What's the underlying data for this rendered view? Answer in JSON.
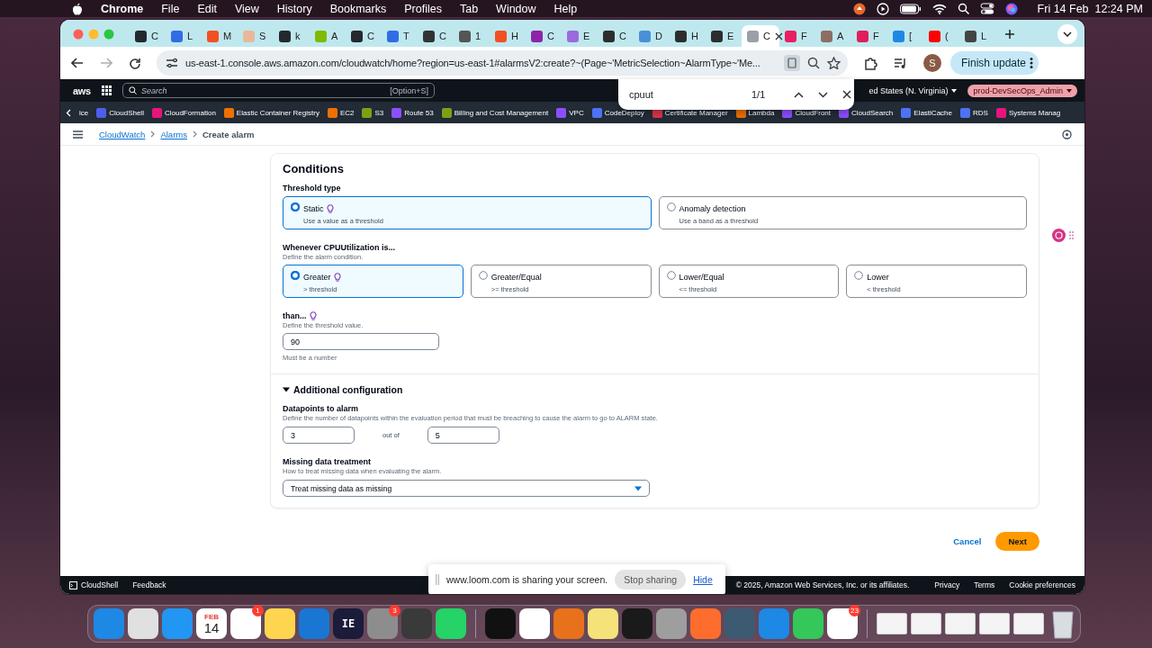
{
  "menu_bar": {
    "app": "Chrome",
    "menus": [
      "File",
      "Edit",
      "View",
      "History",
      "Bookmarks",
      "Profiles",
      "Tab",
      "Window",
      "Help"
    ],
    "clock": "Fri 14 Feb  12:24 PM"
  },
  "browser": {
    "tabs": [
      {
        "label": "C",
        "color": "#24292f",
        "selected": false
      },
      {
        "label": "L",
        "color": "#326ce5",
        "selected": false
      },
      {
        "label": "M",
        "color": "#f25022",
        "selected": false
      },
      {
        "label": "S",
        "color": "#e9b89a",
        "selected": false
      },
      {
        "label": "k",
        "color": "#24292f",
        "selected": false
      },
      {
        "label": "A",
        "color": "#7fba00",
        "selected": false
      },
      {
        "label": "C",
        "color": "#24292f",
        "selected": false
      },
      {
        "label": "T",
        "color": "#326ce5",
        "selected": false
      },
      {
        "label": "C",
        "color": "#333333",
        "selected": false
      },
      {
        "label": "1",
        "color": "#555555",
        "selected": false
      },
      {
        "label": "H",
        "color": "#f25022",
        "selected": false
      },
      {
        "label": "C",
        "color": "#8e24aa",
        "selected": false
      },
      {
        "label": "E",
        "color": "#9c6ade",
        "selected": false
      },
      {
        "label": "C",
        "color": "#2d2d2d",
        "selected": false
      },
      {
        "label": "D",
        "color": "#4a90d9",
        "selected": false
      },
      {
        "label": "H",
        "color": "#2d2d2d",
        "selected": false
      },
      {
        "label": "E",
        "color": "#2d2d2d",
        "selected": false
      },
      {
        "label": "C",
        "color": "#9aa0a6",
        "selected": true
      },
      {
        "label": "F",
        "color": "#e91e63",
        "selected": false
      },
      {
        "label": "A",
        "color": "#8d6e63",
        "selected": false
      },
      {
        "label": "F",
        "color": "#e01e5a",
        "selected": false
      },
      {
        "label": "[",
        "color": "#1e88e5",
        "selected": false
      },
      {
        "label": "(",
        "color": "#ff0000",
        "selected": false
      },
      {
        "label": "L",
        "color": "#444444",
        "selected": false
      }
    ],
    "address": "us-east-1.console.aws.amazon.com/cloudwatch/home?region=us-east-1#alarmsV2:create?~(Page~'MetricSelection~AlarmType~'Me...",
    "profile": "S",
    "update_button": "Finish update"
  },
  "find_bar": {
    "query": "cpuut",
    "count": "1/1"
  },
  "aws_header": {
    "logo": "aws",
    "search_placeholder": "Search",
    "shortcut": "[Option+S]",
    "region": "ed States (N. Virginia)",
    "account": "prod-DevSecOps_Admin"
  },
  "services_cut": "ice",
  "services": [
    {
      "label": "CloudShell",
      "color": "#4d5ee8"
    },
    {
      "label": "CloudFormation",
      "color": "#e7157b"
    },
    {
      "label": "Elastic Container Registry",
      "color": "#ed7100"
    },
    {
      "label": "EC2",
      "color": "#ed7100"
    },
    {
      "label": "S3",
      "color": "#7aa116"
    },
    {
      "label": "Route 53",
      "color": "#8c4fff"
    },
    {
      "label": "Billing and Cost Management",
      "color": "#7aa116"
    },
    {
      "label": "VPC",
      "color": "#8c4fff"
    },
    {
      "label": "CodeDeploy",
      "color": "#4d72f3"
    },
    {
      "label": "Certificate Manager",
      "color": "#dd344c"
    },
    {
      "label": "Lambda",
      "color": "#ed7100"
    },
    {
      "label": "CloudFront",
      "color": "#8c4fff"
    },
    {
      "label": "CloudSearch",
      "color": "#8c4fff"
    },
    {
      "label": "ElastiCache",
      "color": "#4d72f3"
    },
    {
      "label": "RDS",
      "color": "#4d72f3"
    },
    {
      "label": "Systems Manag",
      "color": "#e7157b"
    }
  ],
  "breadcrumbs": [
    {
      "label": "CloudWatch",
      "kind": "link"
    },
    {
      "label": "Alarms",
      "kind": "link"
    },
    {
      "label": "Create alarm",
      "kind": "current"
    }
  ],
  "conditions": {
    "title": "Conditions",
    "threshold_type": {
      "label": "Threshold type",
      "options": [
        {
          "label": "Static",
          "hint": "Use a value as a threshold",
          "info": true,
          "selected": true
        },
        {
          "label": "Anomaly detection",
          "hint": "Use a band as a threshold",
          "info": false,
          "selected": false
        }
      ]
    },
    "whenever": {
      "label": "Whenever CPUUtilization is...",
      "description": "Define the alarm condition.",
      "options": [
        {
          "label": "Greater",
          "hint": "> threshold",
          "info": true,
          "selected": true
        },
        {
          "label": "Greater/Equal",
          "hint": ">= threshold",
          "info": false,
          "selected": false
        },
        {
          "label": "Lower/Equal",
          "hint": "<= threshold",
          "info": false,
          "selected": false
        },
        {
          "label": "Lower",
          "hint": "< threshold",
          "info": false,
          "selected": false
        }
      ]
    },
    "than": {
      "label": "than...",
      "info": true,
      "description": "Define the threshold value.",
      "value": "90",
      "constraint": "Must be a number"
    }
  },
  "additional": {
    "title": "Additional configuration",
    "expanded": true,
    "datapoints": {
      "label": "Datapoints to alarm",
      "description": "Define the number of datapoints within the evaluation period that must be breaching to cause the alarm to go to ALARM state.",
      "first": "3",
      "separator": "out of",
      "second": "5"
    },
    "missing": {
      "label": "Missing data treatment",
      "description": "How to treat missing data when evaluating the alarm.",
      "value": "Treat missing data as missing"
    }
  },
  "actions": {
    "cancel": "Cancel",
    "next": "Next"
  },
  "footer": {
    "cloudshell": "CloudShell",
    "feedback": "Feedback",
    "copyright": "© 2025, Amazon Web Services, Inc. or its affiliates.",
    "links": [
      "Privacy",
      "Terms",
      "Cookie preferences"
    ]
  },
  "sharing_bar": {
    "message": "www.loom.com is sharing your screen.",
    "stop": "Stop sharing",
    "hide": "Hide"
  },
  "dock": {
    "apps": [
      {
        "kind": "app",
        "color": "#1e88e5"
      },
      {
        "kind": "app",
        "color": "#e0e0e0"
      },
      {
        "kind": "app",
        "color": "#2196f3"
      },
      {
        "kind": "calendar",
        "color": "#ffffff",
        "month": "FEB",
        "day": "14"
      },
      {
        "kind": "app",
        "color": "#ffffff",
        "badge": "1"
      },
      {
        "kind": "app",
        "color": "#ffd54f"
      },
      {
        "kind": "app",
        "color": "#1976d2"
      },
      {
        "kind": "label",
        "color": "#1b1b3a",
        "label": "IE"
      },
      {
        "kind": "app",
        "color": "#8d8d8d",
        "badge": "3"
      },
      {
        "kind": "app",
        "color": "#3a3a3a"
      },
      {
        "kind": "app",
        "color": "#25d366"
      },
      {
        "kind": "separator",
        "color": "#9e8e9e"
      },
      {
        "kind": "app",
        "color": "#111111"
      },
      {
        "kind": "app",
        "color": "#ffffff"
      },
      {
        "kind": "app",
        "color": "#e8711c"
      },
      {
        "kind": "app",
        "color": "#f5e27a"
      },
      {
        "kind": "app",
        "color": "#1a1a1a"
      },
      {
        "kind": "app",
        "color": "#9e9e9e"
      },
      {
        "kind": "app",
        "color": "#ff6d2e"
      },
      {
        "kind": "app",
        "color": "#3d5a73"
      },
      {
        "kind": "app",
        "color": "#1e88e5"
      },
      {
        "kind": "app",
        "color": "#34c759"
      },
      {
        "kind": "app",
        "color": "#ffffff",
        "badge": "23"
      },
      {
        "kind": "separator",
        "color": "#9e8e9e"
      },
      {
        "kind": "window",
        "color": "#f4f4f4"
      },
      {
        "kind": "window",
        "color": "#f4f4f4"
      },
      {
        "kind": "window",
        "color": "#f4f4f4"
      },
      {
        "kind": "window",
        "color": "#f4f4f4"
      },
      {
        "kind": "window",
        "color": "#f4f4f4"
      },
      {
        "kind": "trash",
        "color": "#d8dde2"
      }
    ]
  }
}
